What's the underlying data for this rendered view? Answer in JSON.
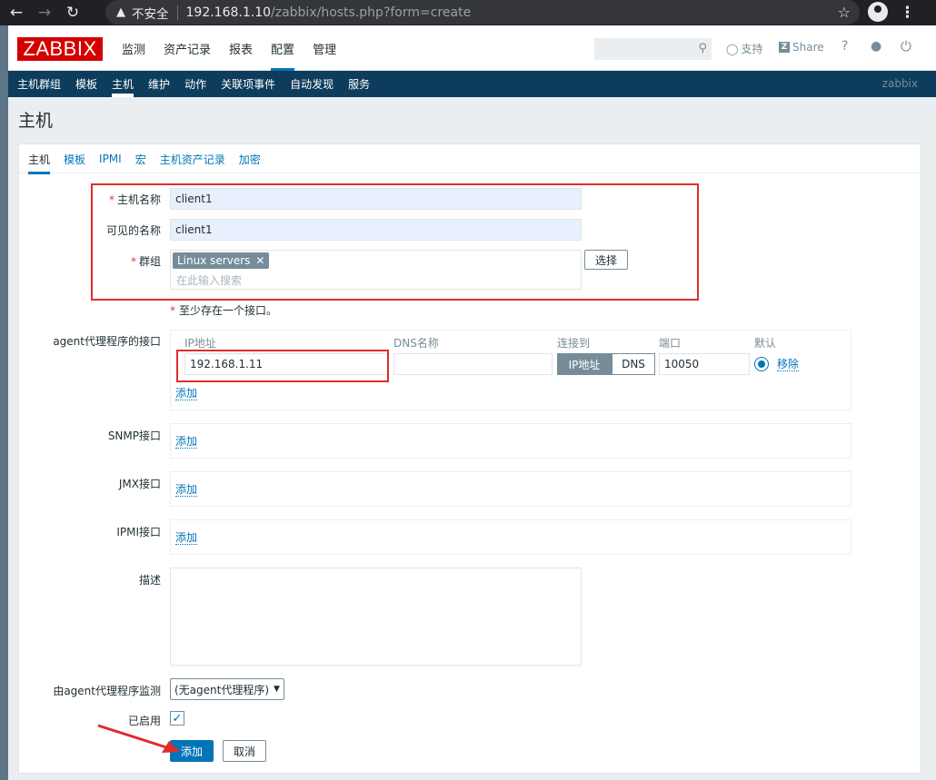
{
  "browser": {
    "security_icon": "warning-triangle-icon",
    "insecure_label": "不安全",
    "host": "192.168.1.10",
    "path": "/zabbix/hosts.php?form=create"
  },
  "header": {
    "logo": "ZABBIX",
    "menu": [
      {
        "label": "监测",
        "selected": false
      },
      {
        "label": "资产记录",
        "selected": false
      },
      {
        "label": "报表",
        "selected": false
      },
      {
        "label": "配置",
        "selected": true
      },
      {
        "label": "管理",
        "selected": false
      }
    ],
    "search_placeholder": "",
    "support_label": "支持",
    "share_label": "Share",
    "help_label": "?"
  },
  "subnav": {
    "items": [
      {
        "label": "主机群组",
        "selected": false
      },
      {
        "label": "模板",
        "selected": false
      },
      {
        "label": "主机",
        "selected": true
      },
      {
        "label": "维护",
        "selected": false
      },
      {
        "label": "动作",
        "selected": false
      },
      {
        "label": "关联项事件",
        "selected": false
      },
      {
        "label": "自动发现",
        "selected": false
      },
      {
        "label": "服务",
        "selected": false
      }
    ],
    "user": "zabbix"
  },
  "page_title": "主机",
  "tabs": [
    {
      "label": "主机",
      "selected": true
    },
    {
      "label": "模板",
      "selected": false
    },
    {
      "label": "IPMI",
      "selected": false
    },
    {
      "label": "宏",
      "selected": false
    },
    {
      "label": "主机资产记录",
      "selected": false
    },
    {
      "label": "加密",
      "selected": false
    }
  ],
  "form": {
    "hostname": {
      "label": "主机名称",
      "required_mark": "*",
      "value": "client1"
    },
    "visible_name": {
      "label": "可见的名称",
      "value": "client1"
    },
    "groups": {
      "label": "群组",
      "required_mark": "*",
      "chips": [
        "Linux servers"
      ],
      "remove_glyph": "✕",
      "placeholder": "在此输入搜索",
      "select_button": "选择"
    },
    "interface_hint": {
      "mark": "*",
      "text": "至少存在一个接口。"
    },
    "agent_interfaces": {
      "label": "agent代理程序的接口",
      "columns": {
        "ip": "IP地址",
        "dns": "DNS名称",
        "connect": "连接到",
        "port": "端口",
        "default": "默认"
      },
      "row": {
        "ip": "192.168.1.11",
        "dns": "",
        "connect_ip": "IP地址",
        "connect_dns": "DNS",
        "connect_selected": "IP地址",
        "port": "10050",
        "remove": "移除"
      },
      "add": "添加"
    },
    "snmp": {
      "label": "SNMP接口",
      "add": "添加"
    },
    "jmx": {
      "label": "JMX接口",
      "add": "添加"
    },
    "ipmi": {
      "label": "IPMI接口",
      "add": "添加"
    },
    "description": {
      "label": "描述",
      "value": ""
    },
    "proxy": {
      "label": "由agent代理程序监测",
      "value": "(无agent代理程序)"
    },
    "enabled": {
      "label": "已启用",
      "checked": true
    },
    "buttons": {
      "add": "添加",
      "cancel": "取消"
    }
  },
  "annotation_color": "#e02c2c",
  "accent_color": "#0275b8"
}
